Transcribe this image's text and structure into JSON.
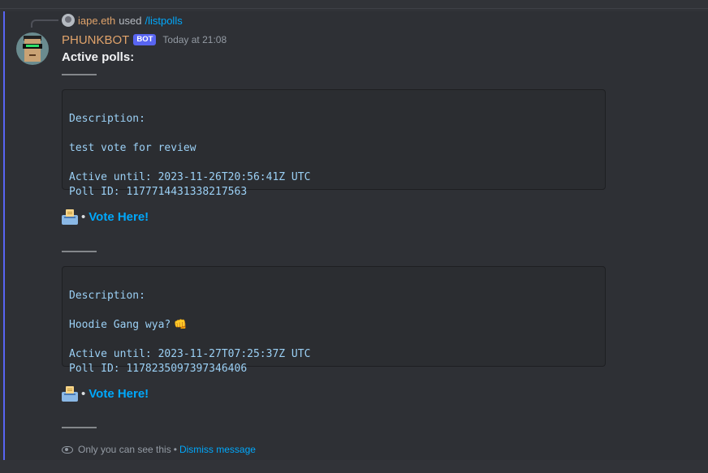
{
  "reply": {
    "username": "iape.eth",
    "used_text": "used",
    "command": "/listpolls"
  },
  "message": {
    "author": "PHUNKBOT",
    "bot_tag": "BOT",
    "timestamp": "Today at 21:08",
    "heading": "Active polls:",
    "separator": "———"
  },
  "polls": [
    {
      "desc_label": "Description:",
      "description": "test vote for review",
      "active_until": "Active until: 2023-11-26T20:56:41Z UTC",
      "poll_id": "Poll ID: 1177714431338217563",
      "vote_link": "Vote Here!"
    },
    {
      "desc_label": "Description:",
      "description": "Hoodie Gang wya?",
      "emoji": "👊",
      "active_until": "Active until: 2023-11-27T07:25:37Z UTC",
      "poll_id": "Poll ID: 1178235097397346406",
      "vote_link": "Vote Here!"
    }
  ],
  "vote_separator": "•",
  "ephemeral": {
    "note": "Only you can see this",
    "separator": "•",
    "dismiss": "Dismiss message"
  },
  "icons": {
    "ballot": "ballot-box-icon",
    "eye": "eye-icon"
  },
  "colors": {
    "accent": "#5865f2",
    "link": "#00a8fc",
    "username": "#e0a36b"
  }
}
